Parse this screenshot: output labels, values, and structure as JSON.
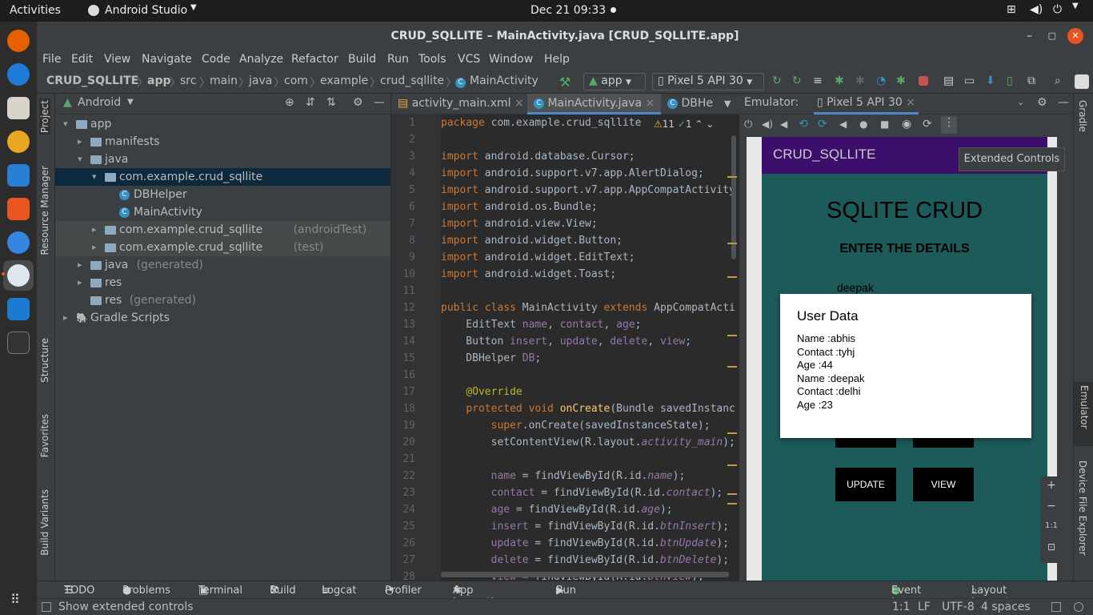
{
  "topbar": {
    "activities": "Activities",
    "app": "Android Studio",
    "datetime": "Dec 21  09:33"
  },
  "window_title": "CRUD_SQLLITE – MainActivity.java [CRUD_SQLLITE.app]",
  "menu": [
    "File",
    "Edit",
    "View",
    "Navigate",
    "Code",
    "Analyze",
    "Refactor",
    "Build",
    "Run",
    "Tools",
    "VCS",
    "Window",
    "Help"
  ],
  "breadcrumb": [
    "CRUD_SQLLITE",
    "app",
    "src",
    "main",
    "java",
    "com",
    "example",
    "crud_sqllite",
    "MainActivity"
  ],
  "toolbar": {
    "config": "app",
    "device": "Pixel 5 API 30"
  },
  "left_tabs": [
    "Project",
    "Resource Manager",
    "Structure",
    "Favorites",
    "Build Variants"
  ],
  "project": {
    "view": "Android",
    "tree": [
      {
        "label": "app",
        "indent": 0,
        "arrow": "▾",
        "icon": "folder"
      },
      {
        "label": "manifests",
        "indent": 1,
        "arrow": "▸",
        "icon": "folder"
      },
      {
        "label": "java",
        "indent": 1,
        "arrow": "▾",
        "icon": "folder"
      },
      {
        "label": "com.example.crud_sqllite",
        "indent": 2,
        "arrow": "▾",
        "icon": "folder",
        "selected": true
      },
      {
        "label": "DBHelper",
        "indent": 3,
        "arrow": "",
        "icon": "class"
      },
      {
        "label": "MainActivity",
        "indent": 3,
        "arrow": "",
        "icon": "class"
      },
      {
        "label": "com.example.crud_sqllite",
        "suffix": "(androidTest)",
        "indent": 2,
        "arrow": "▸",
        "icon": "folder",
        "hl": true
      },
      {
        "label": "com.example.crud_sqllite",
        "suffix": "(test)",
        "indent": 2,
        "arrow": "▸",
        "icon": "folder",
        "hl": true
      },
      {
        "label": "java",
        "suffix": "(generated)",
        "indent": 1,
        "arrow": "▸",
        "icon": "folder"
      },
      {
        "label": "res",
        "indent": 1,
        "arrow": "▸",
        "icon": "folder"
      },
      {
        "label": "res",
        "suffix": "(generated)",
        "indent": 1,
        "arrow": "",
        "icon": "folder"
      },
      {
        "label": "Gradle Scripts",
        "indent": 0,
        "arrow": "▸",
        "icon": "gradle"
      }
    ]
  },
  "editor": {
    "tabs": [
      "activity_main.xml",
      "MainActivity.java",
      "DBHe"
    ],
    "inspection": {
      "warnings": "11",
      "weak": "1"
    },
    "lines": [
      {
        "n": "1",
        "html": "<span class=kw>package</span> com.example.crud_sqllite"
      },
      {
        "n": "2",
        "html": ""
      },
      {
        "n": "3",
        "html": "<span class=kw>import</span> android.database.Cursor;"
      },
      {
        "n": "4",
        "html": "<span class=kw>import</span> android.support.v7.app.AlertDialog;"
      },
      {
        "n": "5",
        "html": "<span class=kw>import</span> android.support.v7.app.AppCompatActivity"
      },
      {
        "n": "6",
        "html": "<span class=kw>import</span> android.os.Bundle;"
      },
      {
        "n": "7",
        "html": "<span class=kw>import</span> android.view.View;"
      },
      {
        "n": "8",
        "html": "<span class=kw>import</span> android.widget.Button;"
      },
      {
        "n": "9",
        "html": "<span class=kw>import</span> android.widget.EditText;"
      },
      {
        "n": "10",
        "html": "<span class=kw>import</span> android.widget.Toast;"
      },
      {
        "n": "11",
        "html": ""
      },
      {
        "n": "12",
        "html": "<span class=kw>public class</span> MainActivity <span class=kw>extends</span> AppCompatActi"
      },
      {
        "n": "13",
        "html": "    EditText <span class=fld>name</span>, <span class=fld>contact</span>, <span class=fld>age</span>;"
      },
      {
        "n": "14",
        "html": "    Button <span class=fld>insert</span>, <span class=fld>update</span>, <span class=fld>delete</span>, <span class=fld>view</span>;"
      },
      {
        "n": "15",
        "html": "    DBHelper <span class=fld>DB</span>;"
      },
      {
        "n": "16",
        "html": ""
      },
      {
        "n": "17",
        "html": "    <span class=an>@Override</span>"
      },
      {
        "n": "18",
        "html": "    <span class=kw>protected void</span> <span class=fn>onCreate</span>(Bundle savedInstanc"
      },
      {
        "n": "19",
        "html": "        <span class=kw>super</span>.onCreate(savedInstanceState);"
      },
      {
        "n": "20",
        "html": "        setContentView(R.layout.<span class=it>activity_main</span>);"
      },
      {
        "n": "21",
        "html": ""
      },
      {
        "n": "22",
        "html": "        <span class=fld>name</span> = findViewById(R.id.<span class=it>name</span>);"
      },
      {
        "n": "23",
        "html": "        <span class=fld>contact</span> = findViewById(R.id.<span class=it>contact</span>);"
      },
      {
        "n": "24",
        "html": "        <span class=fld>age</span> = findViewById(R.id.<span class=it>age</span>);"
      },
      {
        "n": "25",
        "html": "        <span class=fld>insert</span> = findViewById(R.id.<span class=it>btnInsert</span>);"
      },
      {
        "n": "26",
        "html": "        <span class=fld>update</span> = findViewById(R.id.<span class=it>btnUpdate</span>);"
      },
      {
        "n": "27",
        "html": "        <span class=fld>delete</span> = findViewById(R.id.<span class=it>btnDelete</span>);"
      },
      {
        "n": "28",
        "html": "        <span class=fld>view</span> = findViewById(R.id.<span class=it>btnView</span>);"
      }
    ]
  },
  "emulator": {
    "label": "Emulator:",
    "tab": "Pixel 5 API 30",
    "tooltip": "Extended Controls",
    "app": {
      "bar_title": "CRUD_SQLLITE",
      "heading": "SQLITE CRUD",
      "subheading": "ENTER THE DETAILS",
      "name_value": "deepak",
      "btn_update": "UPDATE",
      "btn_view": "VIEW"
    },
    "dialog": {
      "title": "User Data",
      "lines": [
        "Name :abhis",
        "Contact :tyhj",
        "Age :44",
        "Name :deepak",
        "Contact :delhi",
        "Age :23"
      ]
    },
    "zoom": {
      "plus": "+",
      "minus": "−",
      "ratio": "1:1"
    }
  },
  "right_tabs": [
    "Gradle",
    "Emulator",
    "Device File Explorer"
  ],
  "bottom_tabs": [
    "TODO",
    "Problems",
    "Terminal",
    "Build",
    "Logcat",
    "Profiler",
    "App Inspection",
    "Run"
  ],
  "bottom_right": [
    "Event Log",
    "Layout Inspector"
  ],
  "status": {
    "message": "Show extended controls",
    "pos": "1:1",
    "lf": "LF",
    "enc": "UTF-8",
    "indent": "4 spaces"
  },
  "colors": {
    "app_bar": "#3b0f6b",
    "app_bg": "#1d5a5a",
    "btn": "#000000"
  }
}
